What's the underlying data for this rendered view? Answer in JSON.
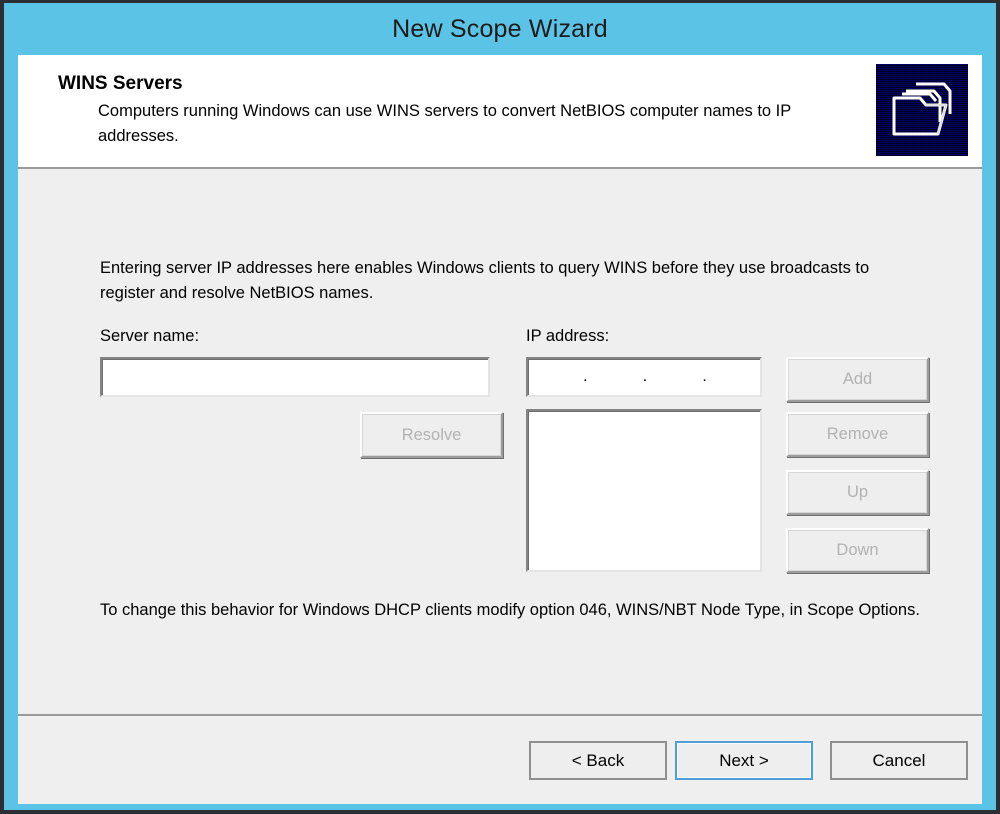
{
  "window": {
    "title": "New Scope Wizard",
    "titlebar_color": "#5bc3e5",
    "dialog_bg": "#efefef"
  },
  "header": {
    "title": "WINS Servers",
    "subtitle": "Computers running Windows can use WINS servers to convert NetBIOS computer names to IP addresses.",
    "icon": "folder-stack-icon"
  },
  "content": {
    "intro_text": "Entering server IP addresses here enables Windows clients to query WINS before they use broadcasts to register and resolve NetBIOS names.",
    "footer_note": "To change this behavior for Windows DHCP clients modify option 046, WINS/NBT Node Type, in Scope Options.",
    "server_name": {
      "label": "Server name:",
      "value": "",
      "placeholder": ""
    },
    "ip_address": {
      "label": "IP address:",
      "octet1": "",
      "octet2": "",
      "octet3": "",
      "octet4": "",
      "separator": "."
    },
    "wins_list": {
      "items": []
    },
    "buttons": {
      "resolve": {
        "label": "Resolve",
        "enabled": false
      },
      "add": {
        "label": "Add",
        "enabled": false
      },
      "remove": {
        "label": "Remove",
        "enabled": false
      },
      "up": {
        "label": "Up",
        "enabled": false
      },
      "down": {
        "label": "Down",
        "enabled": false
      }
    }
  },
  "footer": {
    "back": "< Back",
    "next": "Next >",
    "cancel": "Cancel",
    "default_button": "next"
  }
}
